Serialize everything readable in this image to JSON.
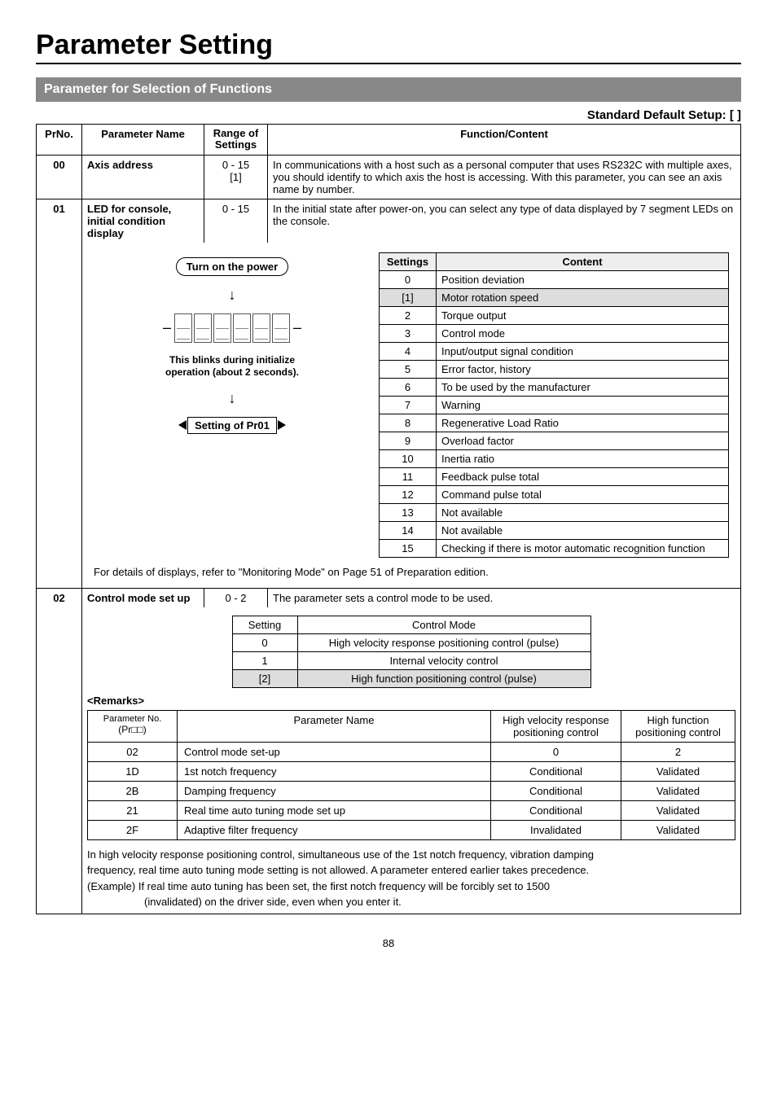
{
  "page_title": "Parameter Setting",
  "section_bar": "Parameter for Selection of Functions",
  "default_setup": "Standard Default Setup: [   ]",
  "headers": {
    "prno": "PrNo.",
    "name": "Parameter Name",
    "range_l1": "Range of",
    "range_l2": "Settings",
    "func": "Function/Content"
  },
  "row00": {
    "prno": "00",
    "name": "Axis address",
    "range_l1": "0 - 15",
    "range_l2": "[1]",
    "func": "In communications with a host such as a personal computer that uses RS232C with multiple axes, you should identify to which axis the host is accessing.  With this parameter, you can see an axis name by number."
  },
  "row01": {
    "prno": "01",
    "name": "LED for console, initial condition display",
    "range": "0 - 15",
    "func": "In the initial state after power-on, you can select any type of data displayed by 7 segment LEDs on the console.",
    "flow": {
      "turn_on": "Turn on the power",
      "blink_l1": "This blinks during initialize",
      "blink_l2": "operation (about 2 seconds).",
      "setting_tag": "Setting of Pr01"
    },
    "settings_hdr": {
      "s": "Settings",
      "c": "Content"
    },
    "settings": [
      {
        "s": "0",
        "c": "Position deviation"
      },
      {
        "s": "[1]",
        "c": "Motor rotation speed"
      },
      {
        "s": "2",
        "c": "Torque output"
      },
      {
        "s": "3",
        "c": "Control mode"
      },
      {
        "s": "4",
        "c": "Input/output signal condition"
      },
      {
        "s": "5",
        "c": "Error factor, history"
      },
      {
        "s": "6",
        "c": "To be used by the manufacturer"
      },
      {
        "s": "7",
        "c": "Warning"
      },
      {
        "s": "8",
        "c": "Regenerative Load Ratio"
      },
      {
        "s": "9",
        "c": "Overload factor"
      },
      {
        "s": "10",
        "c": "Inertia ratio"
      },
      {
        "s": "11",
        "c": "Feedback pulse total"
      },
      {
        "s": "12",
        "c": "Command pulse total"
      },
      {
        "s": "13",
        "c": "Not available"
      },
      {
        "s": "14",
        "c": "Not available"
      },
      {
        "s": "15",
        "c": "Checking if there is motor automatic recognition function"
      }
    ],
    "ref_note": "For details of displays, refer to \"Monitoring Mode\" on Page 51 of Preparation edition."
  },
  "row02": {
    "prno": "02",
    "name": "Control mode set up",
    "range": "0 - 2",
    "func": "The parameter sets a control mode to be used.",
    "mode_hdr": {
      "s": "Setting",
      "c": "Control Mode"
    },
    "modes": [
      {
        "s": "0",
        "c": "High velocity response positioning control (pulse)"
      },
      {
        "s": "1",
        "c": "Internal velocity control"
      },
      {
        "s": "[2]",
        "c": "High function positioning control (pulse)"
      }
    ],
    "remarks_label": "<Remarks>",
    "remarks_hdr": {
      "no_l1": "Parameter No.",
      "no_l2": "(Pr□□)",
      "pname": "Parameter Name",
      "hv_l1": "High velocity response",
      "hv_l2": "positioning control",
      "hf_l1": "High function",
      "hf_l2": "positioning control"
    },
    "remarks": [
      {
        "no": "02",
        "pname": "Control mode set-up",
        "hv": "0",
        "hf": "2"
      },
      {
        "no": "1D",
        "pname": "1st notch frequency",
        "hv": "Conditional",
        "hf": "Validated"
      },
      {
        "no": "2B",
        "pname": "Damping frequency",
        "hv": "Conditional",
        "hf": "Validated"
      },
      {
        "no": "21",
        "pname": "Real time auto tuning mode set up",
        "hv": "Conditional",
        "hf": "Validated"
      },
      {
        "no": "2F",
        "pname": "Adaptive filter frequency",
        "hv": "Invalidated",
        "hf": "Validated"
      }
    ],
    "note_l1": "In high velocity response positioning control, simultaneous use of the 1st notch frequency, vibration damping",
    "note_l2": "frequency, real time auto tuning mode setting is not allowed.  A parameter entered earlier takes precedence.",
    "note_l3": "(Example)  If real time auto tuning has been set, the first notch frequency will be forcibly set to 1500",
    "note_l4": "(invalidated) on the driver side, even when you enter it."
  },
  "page_num": "88"
}
